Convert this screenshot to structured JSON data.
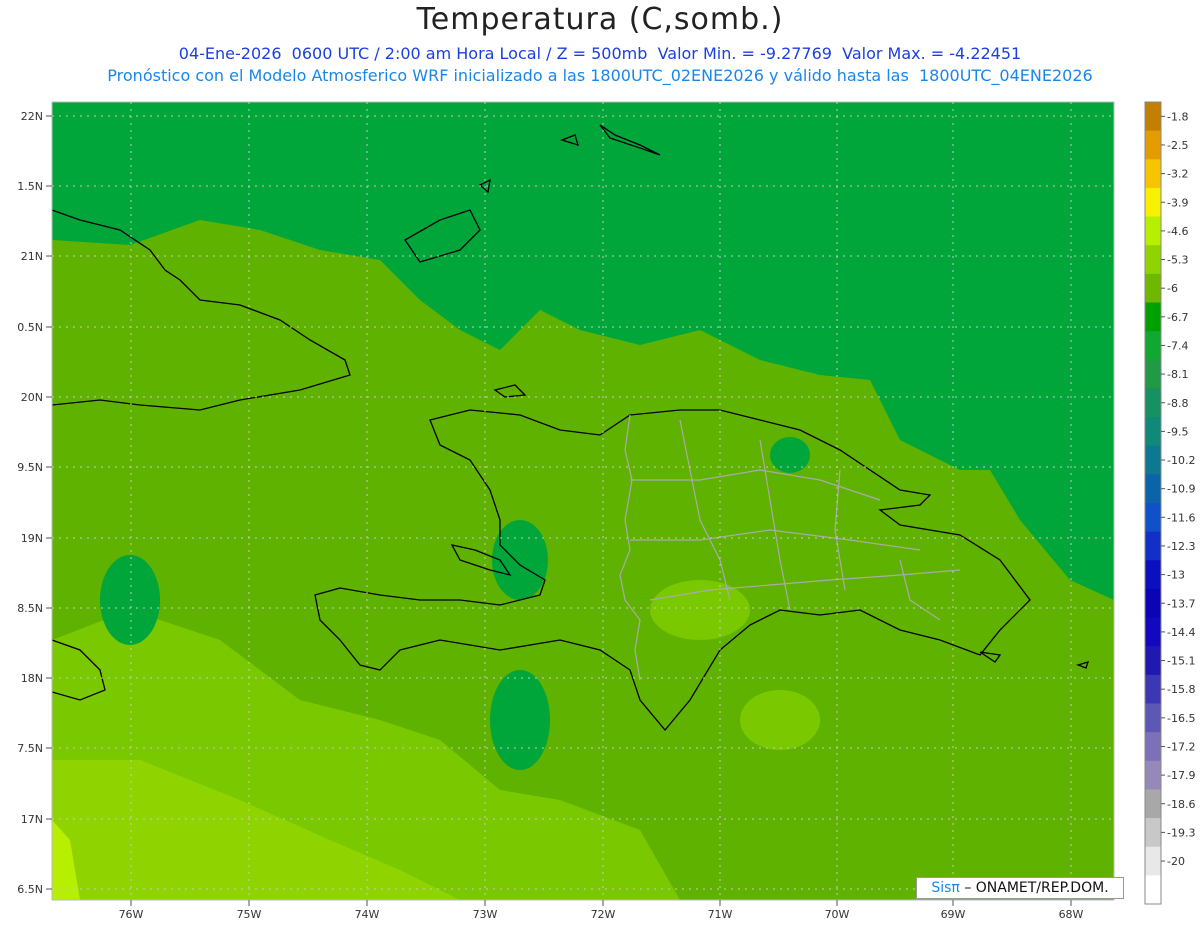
{
  "header": {
    "title": "Temperatura (C,somb.)",
    "line1": "04-Ene-2026  0600 UTC / 2:00 am Hora Local / Z = 500mb  Valor Min. = -9.27769  Valor Max. = -4.22451",
    "line2": "Pronóstico con el Modelo Atmosferico WRF inicializado a las 1800UTC_02ENE2026 y válido hasta las  1800UTC_04ENE2026"
  },
  "map": {
    "lat_labels": [
      "22N",
      "1.5N",
      "21N",
      "0.5N",
      "20N",
      "9.5N",
      "19N",
      "8.5N",
      "18N",
      "7.5N",
      "17N",
      "6.5N"
    ],
    "lon_labels": [
      "76W",
      "75W",
      "74W",
      "73W",
      "72W",
      "71W",
      "70W",
      "69W",
      "68W"
    ],
    "colors": {
      "dark_green": "#00a63a",
      "mid_green": "#5fb200",
      "light_green": "#7ac800",
      "lime": "#9cdd00",
      "bright": "#b6ef00"
    }
  },
  "colorbar": {
    "labels": [
      "-1.8",
      "-2.5",
      "-3.2",
      "-3.9",
      "-4.6",
      "-5.3",
      "-6",
      "-6.7",
      "-7.4",
      "-8.1",
      "-8.8",
      "-9.5",
      "-10.2",
      "-10.9",
      "-11.6",
      "-12.3",
      "-13",
      "-13.7",
      "-14.4",
      "-15.1",
      "-15.8",
      "-16.5",
      "-17.2",
      "-17.9",
      "-18.6",
      "-19.3",
      "-20"
    ],
    "colors": [
      "#c37f00",
      "#e59c00",
      "#f7c400",
      "#f7f100",
      "#b6ef00",
      "#8fd400",
      "#6fb800",
      "#00a000",
      "#10a830",
      "#209a44",
      "#169162",
      "#108a78",
      "#0e7890",
      "#0c64a8",
      "#1050c8",
      "#1030c8",
      "#0a10c0",
      "#0a04b4",
      "#1208c0",
      "#2018b0",
      "#3c38b4",
      "#5c58b4",
      "#7c70b8",
      "#9688b8",
      "#a8a8a8",
      "#c8c8c8",
      "#e8e8e8",
      "#ffffff"
    ]
  },
  "credit": {
    "logo": "Sisπ",
    "text": "– ONAMET/REP.DOM."
  }
}
